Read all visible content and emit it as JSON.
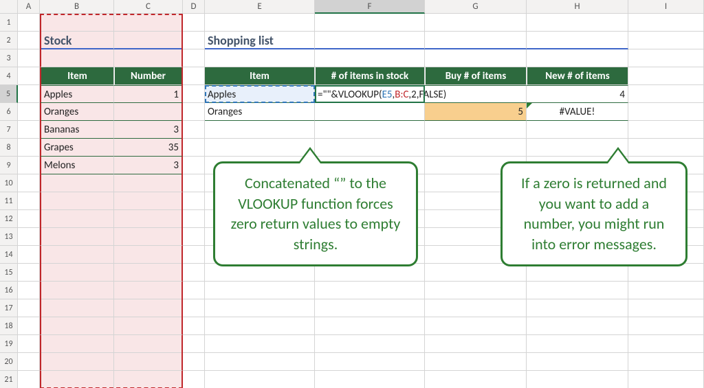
{
  "columns": [
    "A",
    "B",
    "C",
    "D",
    "E",
    "F",
    "G",
    "H",
    "I"
  ],
  "selected_column": "F",
  "selected_row": 5,
  "row_count": 21,
  "sections": {
    "stock_title": "Stock",
    "shopping_title": "Shopping list"
  },
  "stock": {
    "headers": [
      "Item",
      "Number"
    ],
    "rows": [
      {
        "item": "Apples",
        "number": "1"
      },
      {
        "item": "Oranges",
        "number": ""
      },
      {
        "item": "Bananas",
        "number": "3"
      },
      {
        "item": "Grapes",
        "number": "35"
      },
      {
        "item": "Melons",
        "number": "3"
      }
    ]
  },
  "shopping": {
    "headers": [
      "Item",
      "# of items in stock",
      "Buy # of items",
      "New # of items"
    ],
    "rows": [
      {
        "item": "Apples",
        "stock": "",
        "buy": "",
        "newn": "4"
      },
      {
        "item": "Oranges",
        "stock": "",
        "buy": "5",
        "newn": "#VALUE!"
      }
    ]
  },
  "formula": {
    "prefix": "=\"\"&VLOOKUP(",
    "ref1": "E5",
    "sep1": ",",
    "ref2": "B:C",
    "rest": ",2,FALSE)"
  },
  "callouts": {
    "c1": "Concatenated “” to the VLOOKUP function forces zero return values to empty strings.",
    "c2": "If a zero is returned and you want to add a number, you might run into error messages."
  },
  "chart_data": {
    "type": "table",
    "tables": [
      {
        "title": "Stock",
        "columns": [
          "Item",
          "Number"
        ],
        "rows": [
          [
            "Apples",
            1
          ],
          [
            "Oranges",
            null
          ],
          [
            "Bananas",
            3
          ],
          [
            "Grapes",
            35
          ],
          [
            "Melons",
            3
          ]
        ]
      },
      {
        "title": "Shopping list",
        "columns": [
          "Item",
          "# of items in stock",
          "Buy # of items",
          "New # of items"
        ],
        "rows": [
          [
            "Apples",
            "=\"\"&VLOOKUP(E5,B:C,2,FALSE)",
            null,
            4
          ],
          [
            "Oranges",
            null,
            5,
            "#VALUE!"
          ]
        ]
      }
    ]
  }
}
